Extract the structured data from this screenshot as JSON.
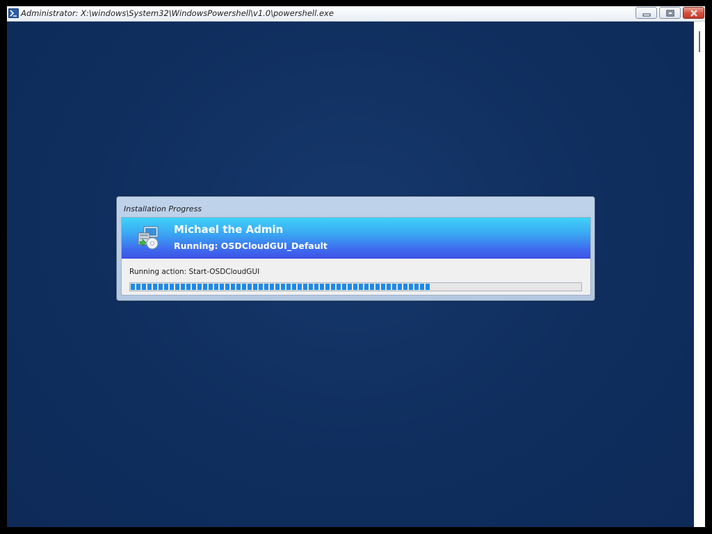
{
  "window": {
    "title": "Administrator: X:\\windows\\System32\\WindowsPowershell\\v1.0\\powershell.exe",
    "icon": "powershell-icon"
  },
  "titlebar_buttons": {
    "minimize_icon": "minimize-icon",
    "maximize_icon": "maximize-icon",
    "close_icon": "close-icon"
  },
  "dialog": {
    "title": "Installation Progress",
    "banner_icon": "installer-computer-icon",
    "heading": "Michael the Admin",
    "subheading": "Running: OSDCloudGUI_Default",
    "action_text": "Running action: Start-OSDCloudGUI",
    "progress": 0.67
  },
  "colors": {
    "console_background": "#0f2e5e",
    "banner_top": "#3fd2f8",
    "banner_bottom": "#3d50e6",
    "progress_fill": "#1f8ae6"
  }
}
